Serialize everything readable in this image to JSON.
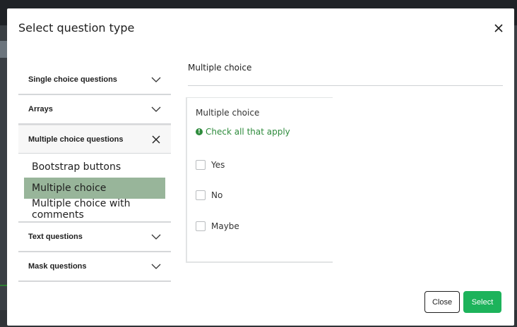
{
  "modal": {
    "title": "Select question type",
    "close_label": "Close",
    "select_label": "Select"
  },
  "accordion": [
    {
      "label": "Single choice questions",
      "open": false
    },
    {
      "label": "Arrays",
      "open": false
    },
    {
      "label": "Multiple choice questions",
      "open": true,
      "options": [
        "Bootstrap buttons",
        "Multiple choice",
        "Multiple choice with comments"
      ],
      "selected": "Multiple choice"
    },
    {
      "label": "Text questions",
      "open": false
    },
    {
      "label": "Mask questions",
      "open": false
    }
  ],
  "preview": {
    "heading": "Multiple choice",
    "question_title": "Multiple choice",
    "help_text": "Check all that apply",
    "answer_options": [
      "Yes",
      "No",
      "Maybe"
    ]
  },
  "colors": {
    "selected_option_bg": "#98b59a",
    "help_green": "#2e8b3c",
    "select_button": "#1db35b"
  },
  "icons": {
    "collapsed": "chevron-down-icon",
    "expanded": "close-icon",
    "help": "exclamation-circle-icon"
  }
}
